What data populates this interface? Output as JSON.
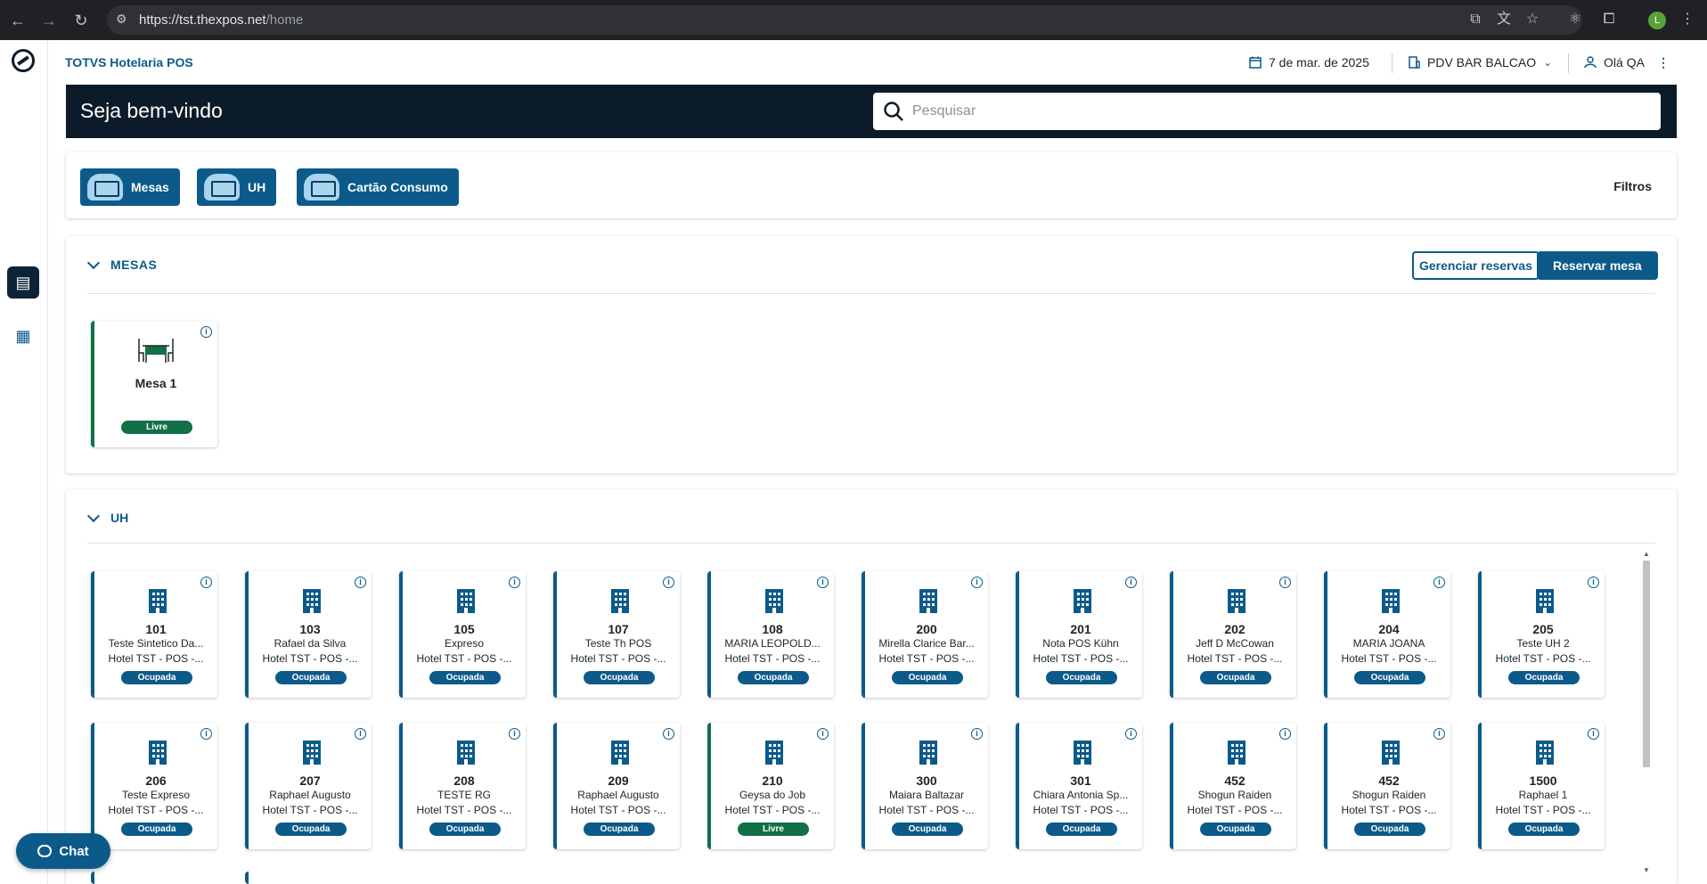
{
  "browser": {
    "url_host": "https://tst.thexpos.net",
    "url_path": "/home",
    "avatar_letter": "L"
  },
  "header": {
    "app_title": "TOTVS Hotelaria POS",
    "date": "7 de mar. de 2025",
    "pdv": "PDV BAR BALCAO",
    "greeting": "Olá QA"
  },
  "banner": {
    "welcome": "Seja bem-vindo",
    "search_placeholder": "Pesquisar"
  },
  "filters": {
    "buttons": [
      "Mesas",
      "UH",
      "Cartão Consumo"
    ],
    "filtros_label": "Filtros"
  },
  "mesas": {
    "title": "MESAS",
    "manage_label": "Gerenciar reservas",
    "reserve_label": "Reservar mesa",
    "cards": [
      {
        "name": "Mesa 1",
        "status": "Livre"
      }
    ]
  },
  "uh": {
    "title": "UH",
    "rows": [
      [
        {
          "num": "101",
          "guest": "Teste Sintetico Da...",
          "hotel": "Hotel TST - POS -...",
          "status": "Ocupada"
        },
        {
          "num": "103",
          "guest": "Rafael da Silva",
          "hotel": "Hotel TST - POS -...",
          "status": "Ocupada"
        },
        {
          "num": "105",
          "guest": "Expreso",
          "hotel": "Hotel TST - POS -...",
          "status": "Ocupada"
        },
        {
          "num": "107",
          "guest": "Teste Th POS",
          "hotel": "Hotel TST - POS -...",
          "status": "Ocupada"
        },
        {
          "num": "108",
          "guest": "MARIA LEOPOLD...",
          "hotel": "Hotel TST - POS -...",
          "status": "Ocupada"
        },
        {
          "num": "200",
          "guest": "Mirella Clarice Bar...",
          "hotel": "Hotel TST - POS -...",
          "status": "Ocupada"
        },
        {
          "num": "201",
          "guest": "Nota POS Kühn",
          "hotel": "Hotel TST - POS -...",
          "status": "Ocupada"
        },
        {
          "num": "202",
          "guest": "Jeff D McCowan",
          "hotel": "Hotel TST - POS -...",
          "status": "Ocupada"
        },
        {
          "num": "204",
          "guest": "MARIA JOANA",
          "hotel": "Hotel TST - POS -...",
          "status": "Ocupada"
        },
        {
          "num": "205",
          "guest": "Teste UH 2",
          "hotel": "Hotel TST - POS -...",
          "status": "Ocupada"
        }
      ],
      [
        {
          "num": "206",
          "guest": "Teste Expreso",
          "hotel": "Hotel TST - POS -...",
          "status": "Ocupada"
        },
        {
          "num": "207",
          "guest": "Raphael Augusto",
          "hotel": "Hotel TST - POS -...",
          "status": "Ocupada"
        },
        {
          "num": "208",
          "guest": "TESTE RG",
          "hotel": "Hotel TST - POS -...",
          "status": "Ocupada"
        },
        {
          "num": "209",
          "guest": "Raphael Augusto",
          "hotel": "Hotel TST - POS -...",
          "status": "Ocupada"
        },
        {
          "num": "210",
          "guest": "Geysa do Job",
          "hotel": "Hotel TST - POS -...",
          "status": "Livre"
        },
        {
          "num": "300",
          "guest": "Maiara Baltazar",
          "hotel": "Hotel TST - POS -...",
          "status": "Ocupada"
        },
        {
          "num": "301",
          "guest": "Chiara Antonia Sp...",
          "hotel": "Hotel TST - POS -...",
          "status": "Ocupada"
        },
        {
          "num": "452",
          "guest": "Shogun Raiden",
          "hotel": "Hotel TST - POS -...",
          "status": "Ocupada"
        },
        {
          "num": "452",
          "guest": "Shogun Raiden",
          "hotel": "Hotel TST - POS -...",
          "status": "Ocupada"
        },
        {
          "num": "1500",
          "guest": "Raphael 1",
          "hotel": "Hotel TST - POS -...",
          "status": "Ocupada"
        }
      ]
    ]
  },
  "chat": {
    "label": "Chat"
  },
  "colors": {
    "primary": "#0c5a8a",
    "dark": "#0c1b2a",
    "livre": "#137046"
  }
}
